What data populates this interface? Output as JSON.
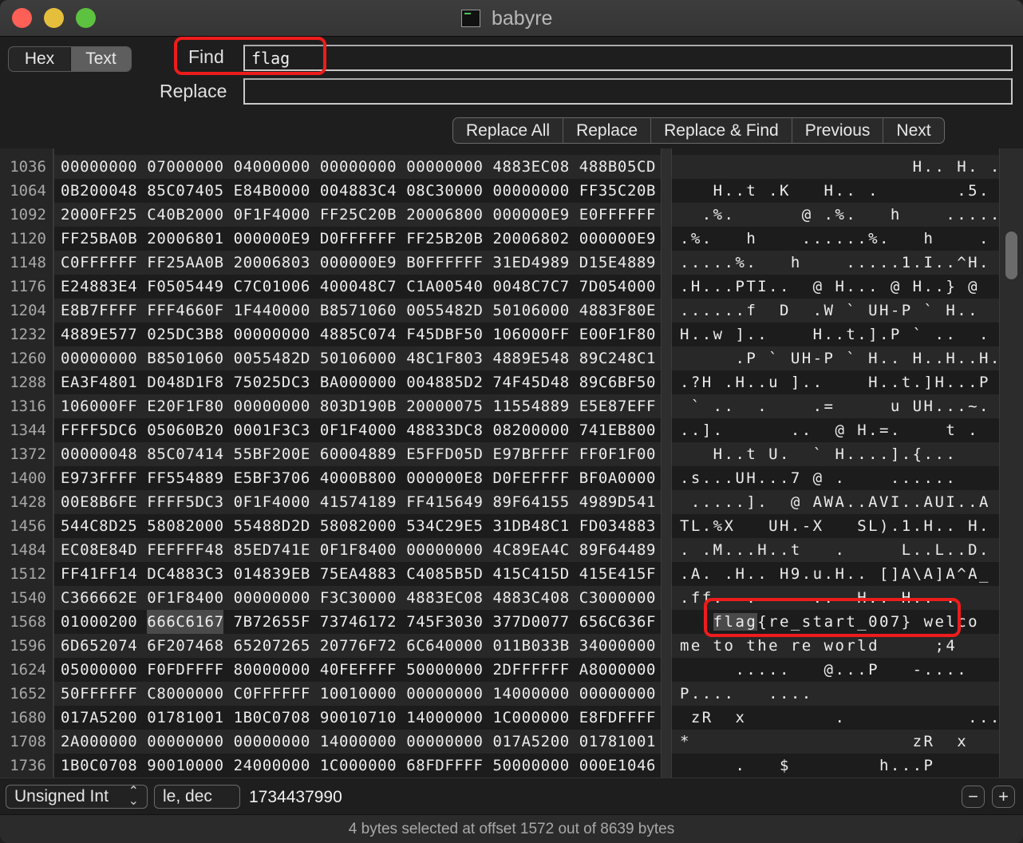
{
  "window": {
    "title": "babyre"
  },
  "toolbar": {
    "view_modes": [
      {
        "label": "Hex",
        "active": false
      },
      {
        "label": "Text",
        "active": true
      }
    ],
    "find_label": "Find",
    "find_value": "flag",
    "replace_label": "Replace",
    "replace_value": "",
    "buttons": [
      "Replace All",
      "Replace",
      "Replace & Find",
      "Previous",
      "Next"
    ]
  },
  "hex_view": {
    "selected_group_row": 1568,
    "selected_group_index": 1,
    "rows": [
      {
        "offset": "1036",
        "hex": [
          "00000000",
          "07000000",
          "04000000",
          "00000000",
          "00000000",
          "4883EC08",
          "488B05CD"
        ],
        "text": "                     H.. H. ."
      },
      {
        "offset": "1064",
        "hex": [
          "0B200048",
          "85C07405",
          "E84B0000",
          "004883C4",
          "08C30000",
          "00000000",
          "FF35C20B"
        ],
        "text": "   H..t .K   H.. .       .5."
      },
      {
        "offset": "1092",
        "hex": [
          "2000FF25",
          "C40B2000",
          "0F1F4000",
          "FF25C20B",
          "20006800",
          "000000E9",
          "E0FFFFFF"
        ],
        "text": "  .%.      @ .%.   h    ....."
      },
      {
        "offset": "1120",
        "hex": [
          "FF25BA0B",
          "20006801",
          "000000E9",
          "D0FFFFFF",
          "FF25B20B",
          "20006802",
          "000000E9"
        ],
        "text": ".%.   h    ......%.   h    ."
      },
      {
        "offset": "1148",
        "hex": [
          "C0FFFFFF",
          "FF25AA0B",
          "20006803",
          "000000E9",
          "B0FFFFFF",
          "31ED4989",
          "D15E4889"
        ],
        "text": ".....%.   h    .....1.I..^H."
      },
      {
        "offset": "1176",
        "hex": [
          "E24883E4",
          "F0505449",
          "C7C01006",
          "400048C7",
          "C1A00540",
          "0048C7C7",
          "7D054000"
        ],
        "text": ".H...PTI..  @ H... @ H..} @"
      },
      {
        "offset": "1204",
        "hex": [
          "E8B7FFFF",
          "FFF4660F",
          "1F440000",
          "B8571060",
          "0055482D",
          "50106000",
          "4883F80E"
        ],
        "text": "......f  D  .W ` UH-P ` H.."
      },
      {
        "offset": "1232",
        "hex": [
          "4889E577",
          "025DC3B8",
          "00000000",
          "4885C074",
          "F45DBF50",
          "106000FF",
          "E00F1F80"
        ],
        "text": "H..w ]..    H..t.].P ` ..  ."
      },
      {
        "offset": "1260",
        "hex": [
          "00000000",
          "B8501060",
          "0055482D",
          "50106000",
          "48C1F803",
          "4889E548",
          "89C248C1"
        ],
        "text": "     .P ` UH-P ` H.. H..H..H."
      },
      {
        "offset": "1288",
        "hex": [
          "EA3F4801",
          "D048D1F8",
          "75025DC3",
          "BA000000",
          "004885D2",
          "74F45D48",
          "89C6BF50"
        ],
        "text": ".?H .H..u ]..    H..t.]H...P"
      },
      {
        "offset": "1316",
        "hex": [
          "106000FF",
          "E20F1F80",
          "00000000",
          "803D190B",
          "20000075",
          "11554889",
          "E5E87EFF"
        ],
        "text": " ` ..  .    .=     u UH...~."
      },
      {
        "offset": "1344",
        "hex": [
          "FFFF5DC6",
          "05060B20",
          "0001F3C3",
          "0F1F4000",
          "48833DC8",
          "08200000",
          "741EB800"
        ],
        "text": "..].      ..  @ H.=.    t ."
      },
      {
        "offset": "1372",
        "hex": [
          "00000048",
          "85C07414",
          "55BF200E",
          "60004889",
          "E5FFD05D",
          "E97BFFFF",
          "FF0F1F00"
        ],
        "text": "   H..t U.  ` H....].{..."
      },
      {
        "offset": "1400",
        "hex": [
          "E973FFFF",
          "FF554889",
          "E5BF3706",
          "4000B800",
          "000000E8",
          "D0FEFFFF",
          "BF0A0000"
        ],
        "text": ".s...UH...7 @ .    ......"
      },
      {
        "offset": "1428",
        "hex": [
          "00E8B6FE",
          "FFFF5DC3",
          "0F1F4000",
          "41574189",
          "FF415649",
          "89F64155",
          "4989D541"
        ],
        "text": " .....].  @ AWA..AVI..AUI..A"
      },
      {
        "offset": "1456",
        "hex": [
          "544C8D25",
          "58082000",
          "55488D2D",
          "58082000",
          "534C29E5",
          "31DB48C1",
          "FD034883"
        ],
        "text": "TL.%X   UH.-X   SL).1.H.. H."
      },
      {
        "offset": "1484",
        "hex": [
          "EC08E84D",
          "FEFFFF48",
          "85ED741E",
          "0F1F8400",
          "00000000",
          "4C89EA4C",
          "89F64489"
        ],
        "text": ". .M...H..t   .     L..L..D."
      },
      {
        "offset": "1512",
        "hex": [
          "FF41FF14",
          "DC4883C3",
          "014839EB",
          "75EA4883",
          "C4085B5D",
          "415C415D",
          "415E415F"
        ],
        "text": ".A. .H.. H9.u.H.. []A\\A]A^A_"
      },
      {
        "offset": "1540",
        "hex": [
          "C366662E",
          "0F1F8400",
          "00000000",
          "F3C30000",
          "4883EC08",
          "4883C408",
          "C3000000"
        ],
        "text": ".ff.  .     ..  H.. H.. ."
      },
      {
        "offset": "1568",
        "hex": [
          "01000200",
          "666C6167",
          "7B72655F",
          "73746172",
          "745F3030",
          "377D0077",
          "656C636F"
        ],
        "text_pre": "   ",
        "text_sel": "flag",
        "text": "{re_start_007} welco"
      },
      {
        "offset": "1596",
        "hex": [
          "6D652074",
          "6F207468",
          "65207265",
          "20776F72",
          "6C640000",
          "011B033B",
          "34000000"
        ],
        "text": "me to the re world     ;4"
      },
      {
        "offset": "1624",
        "hex": [
          "05000000",
          "F0FDFFFF",
          "80000000",
          "40FEFFFF",
          "50000000",
          "2DFFFFFF",
          "A8000000"
        ],
        "text": "     .....   @...P   -...."
      },
      {
        "offset": "1652",
        "hex": [
          "50FFFFFF",
          "C8000000",
          "C0FFFFFF",
          "10010000",
          "00000000",
          "14000000",
          "00000000"
        ],
        "text": "P....   ...."
      },
      {
        "offset": "1680",
        "hex": [
          "017A5200",
          "01781001",
          "1B0C0708",
          "90010710",
          "14000000",
          "1C000000",
          "E8FDFFFF"
        ],
        "text": " zR  x        .           ...."
      },
      {
        "offset": "1708",
        "hex": [
          "2A000000",
          "00000000",
          "00000000",
          "14000000",
          "00000000",
          "017A5200",
          "01781001"
        ],
        "text": "*                    zR  x"
      },
      {
        "offset": "1736",
        "hex": [
          "1B0C0708",
          "90010000",
          "24000000",
          "1C000000",
          "68FDFFFF",
          "50000000",
          "000E1046"
        ],
        "text": "     .   $        h...P      F"
      }
    ]
  },
  "inspector": {
    "type_label": "Unsigned Int",
    "endian_label": "le, dec",
    "value": "1734437990",
    "minus_label": "−",
    "plus_label": "+"
  },
  "status": {
    "text": "4 bytes selected at offset 1572 out of 8639 bytes"
  },
  "colors": {
    "annotation": "#ee1c1c",
    "selection": "#4a4a4a",
    "close": "#fe5f57",
    "minimize": "#e5bf3c",
    "zoom": "#5cc23f"
  }
}
